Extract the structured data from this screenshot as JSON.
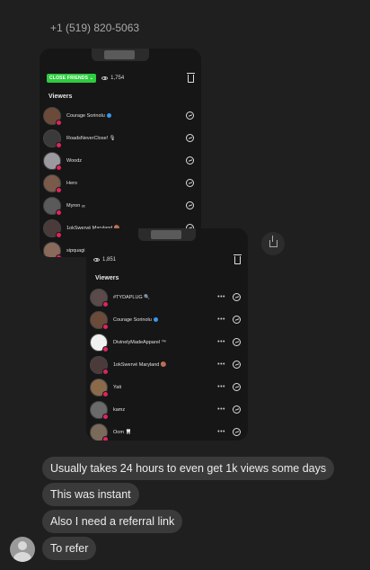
{
  "contact": {
    "phone": "+1 (519) 820-5063"
  },
  "story1": {
    "close_friends_label": "CLOSE FRIENDS ⌄",
    "view_count": "1,754",
    "viewers_title": "Viewers",
    "viewers": [
      {
        "name": "Courage Sorinolu",
        "verified": true,
        "color": "#6b4a3a"
      },
      {
        "name": "RoadsNeverClose! 🎙",
        "verified": false,
        "color": "#3a3a3a"
      },
      {
        "name": "Woodz",
        "verified": false,
        "color": "#9a9aa0"
      },
      {
        "name": "Hero",
        "verified": false,
        "color": "#7a5a4a"
      },
      {
        "name": "Myron ₒₓ",
        "verified": false,
        "color": "#5a5a5a"
      },
      {
        "name": "1okSwervé  Maryland 🟤",
        "verified": false,
        "color": "#4a3a3a"
      },
      {
        "name": "sipquagi",
        "verified": false,
        "color": "#8a6a5a"
      }
    ]
  },
  "story2": {
    "view_count": "1,851",
    "viewers_title": "Viewers",
    "viewers": [
      {
        "name": "#TYDAPLUG 🔍",
        "verified": false,
        "color": "#5a4a4a"
      },
      {
        "name": "Courage Sorinolu",
        "verified": true,
        "color": "#6b4a3a"
      },
      {
        "name": "DivinelyMadeApparel ™",
        "verified": false,
        "color": "#f0f0f0"
      },
      {
        "name": "1okSwervé  Maryland 🟤",
        "verified": false,
        "color": "#4a3a3a"
      },
      {
        "name": "Yati",
        "verified": false,
        "color": "#8a6a4a"
      },
      {
        "name": "kamz",
        "verified": false,
        "color": "#6a6a6a"
      },
      {
        "name": "Oom 🦷",
        "verified": false,
        "color": "#7a6a5a"
      }
    ]
  },
  "messages": [
    "Usually takes 24 hours to even get 1k views some days",
    "This was instant",
    "Also I need a referral link",
    "To refer"
  ]
}
